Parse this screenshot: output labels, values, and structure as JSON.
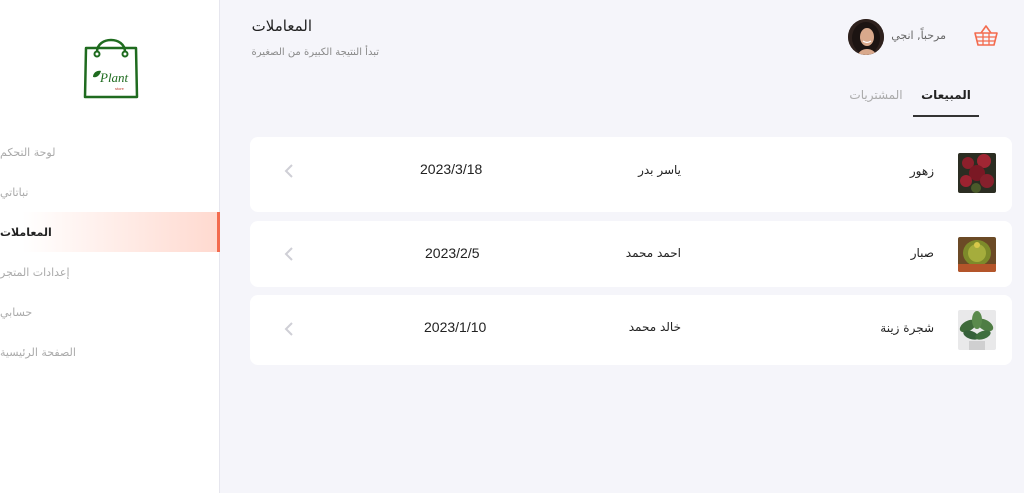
{
  "sidebar": {
    "items": [
      {
        "label": "لوحة التحكم",
        "active": false
      },
      {
        "label": "نباتاتي",
        "active": false
      },
      {
        "label": "المعاملات",
        "active": true
      },
      {
        "label": "إعدادات المتجر",
        "active": false
      },
      {
        "label": "حسابي",
        "active": false
      },
      {
        "label": "الصفحة الرئيسية",
        "active": false
      }
    ]
  },
  "logo": {
    "text": "Plant",
    "subtext": "store"
  },
  "header": {
    "title": "المعاملات",
    "subtitle": "تبدأ النتيجة الكبيرة من الصغيرة",
    "greeting": "مرحباً, انجي",
    "avatar_icon": "user-avatar",
    "cart_icon": "shopping-basket-icon"
  },
  "tabs": [
    {
      "label": "المبيعات",
      "active": true
    },
    {
      "label": "المشتريات",
      "active": false
    }
  ],
  "transactions": [
    {
      "plant": "زهور",
      "person": "ياسر بدر",
      "date": "2023/3/18",
      "thumb": "red-flowers"
    },
    {
      "plant": "صبار",
      "person": "احمد محمد",
      "date": "2023/2/5",
      "thumb": "cactus"
    },
    {
      "plant": "شجرة زينة",
      "person": "خالد محمد",
      "date": "2023/1/10",
      "thumb": "ornamental-plant"
    }
  ],
  "colors": {
    "accent": "#f36b4e",
    "logo_green": "#1f6b1f",
    "background": "#f5f5fa"
  }
}
